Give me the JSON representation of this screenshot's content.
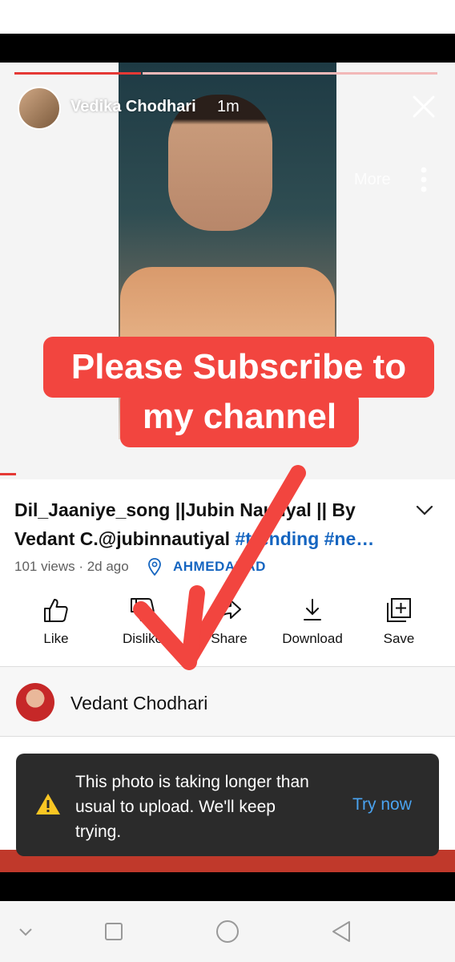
{
  "story": {
    "author": "Vedika Chodhari",
    "time": "1m",
    "more_label": "More",
    "sticker_line1": "Please Subscribe to",
    "sticker_line2": "my channel",
    "progress": 0.3
  },
  "video": {
    "title_plain": "Dil_Jaaniye_song ||Jubin Nautiyal ||  By Vedant C.@jubinnautiyal ",
    "title_tags": "#trending #ne…",
    "meta": "101 views · 2d ago",
    "location": "AHMEDABAD"
  },
  "actions": {
    "like": "Like",
    "dislike": "Dislike",
    "share": "Share",
    "download": "Download",
    "save": "Save"
  },
  "channel": {
    "name": "Vedant Chodhari"
  },
  "toast": {
    "message": "This photo is taking longer than usual to upload. We'll keep trying.",
    "action": "Try now"
  },
  "colors": {
    "accent": "#e53935",
    "link": "#1565c0",
    "toast_bg": "#2b2b2b",
    "toast_action": "#4aa3f0"
  }
}
